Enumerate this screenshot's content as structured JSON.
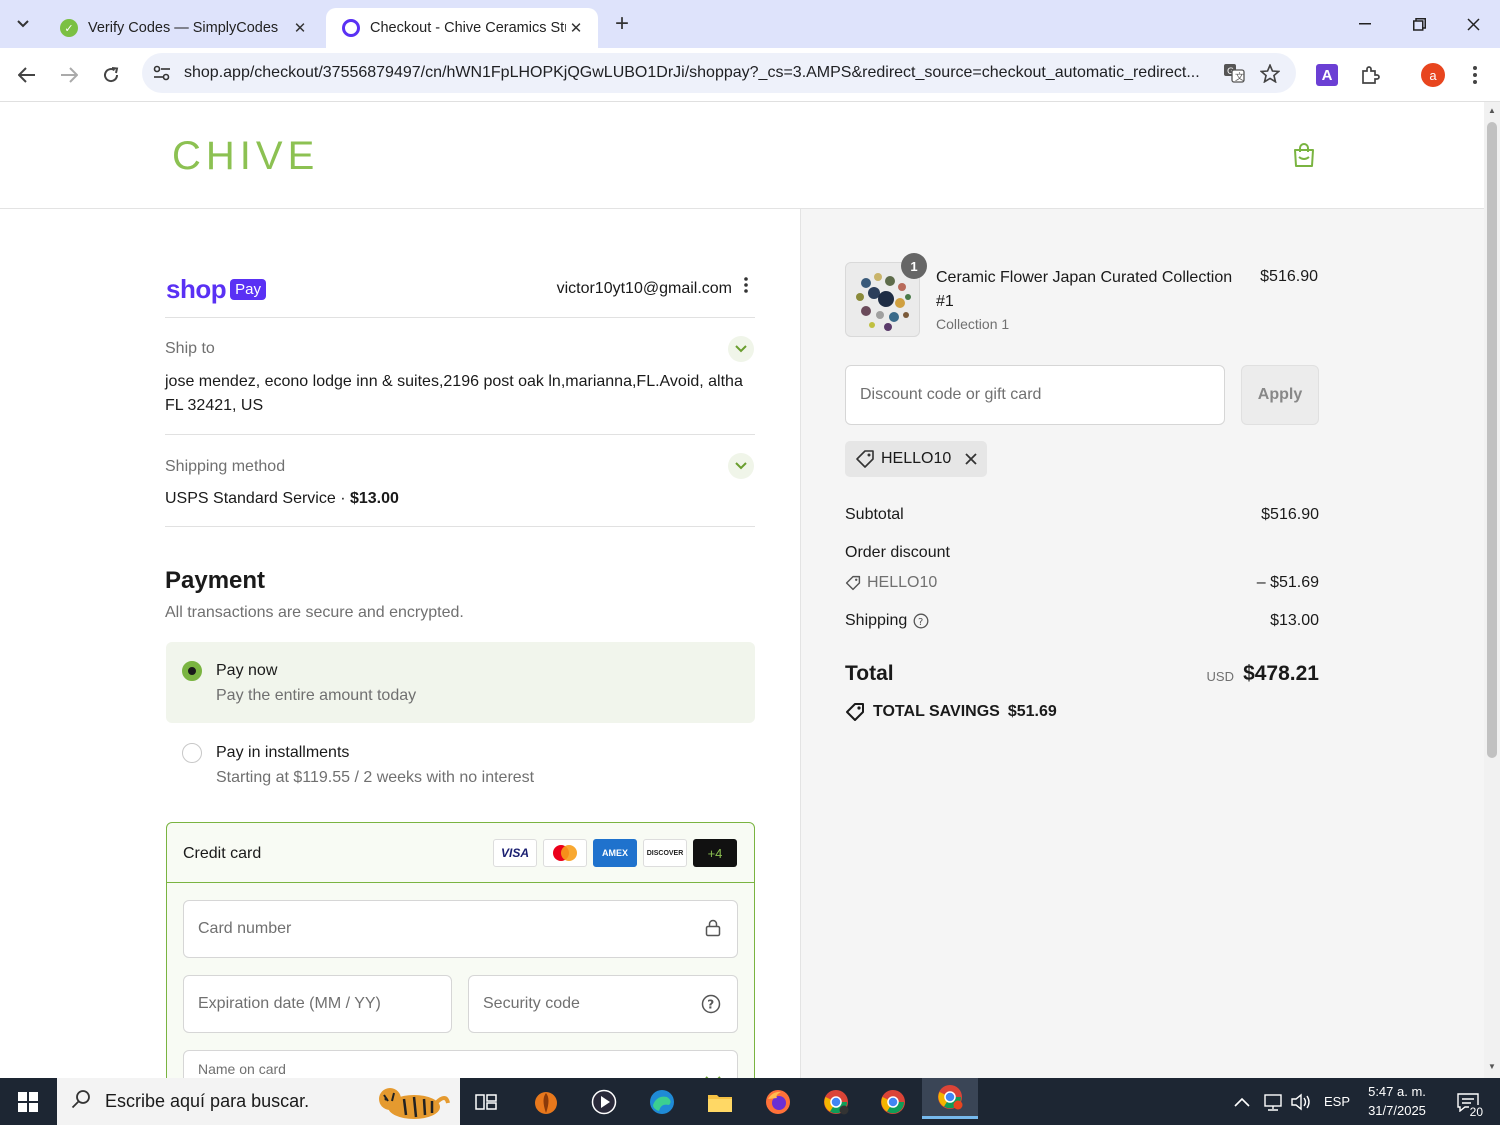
{
  "browser": {
    "tabs": [
      {
        "title": "Verify Codes — SimplyCodes",
        "icon": "simplycodes-icon"
      },
      {
        "title": "Checkout - Chive Ceramics Stud",
        "icon": "shop-icon"
      }
    ],
    "url": "shop.app/checkout/37556879497/cn/hWN1FpLHOPKjQGwLUBO1DrJi/shoppay?_cs=3.AMPS&redirect_source=checkout_automatic_redirect...",
    "profile_initial": "a",
    "extension_letter": "A"
  },
  "header": {
    "logo": "CHIVE"
  },
  "shop_pay": {
    "brand": "shop",
    "badge": "Pay",
    "email": "victor10yt10@gmail.com"
  },
  "ship_to": {
    "label": "Ship to",
    "line1": "jose mendez, econo lodge inn & suites,2196 post oak ln,marianna,FL.Avoid, altha",
    "line2": "FL 32421, US"
  },
  "shipping_method": {
    "label": "Shipping method",
    "service": "USPS Standard Service",
    "separator": " · ",
    "price": "$13.00"
  },
  "payment": {
    "title": "Payment",
    "subtitle": "All transactions are secure and encrypted.",
    "options": [
      {
        "title": "Pay now",
        "subtitle": "Pay the entire amount today",
        "selected": true
      },
      {
        "title": "Pay in installments",
        "subtitle": "Starting at $119.55 / 2 weeks with no interest",
        "selected": false
      }
    ],
    "credit_card": {
      "title": "Credit card",
      "logos": [
        "VISA",
        "MASTERCARD",
        "AMEX",
        "DISCOVER"
      ],
      "more": "+4",
      "fields": {
        "card_number": "Card number",
        "expiration": "Expiration date (MM / YY)",
        "security": "Security code",
        "name": "Name on card"
      }
    }
  },
  "order": {
    "product": {
      "title": "Ceramic Flower Japan Curated Collection #1",
      "variant": "Collection 1",
      "price": "$516.90",
      "quantity": "1"
    },
    "discount_placeholder": "Discount code or gift card",
    "apply_label": "Apply",
    "applied_code": "HELLO10",
    "subtotal_label": "Subtotal",
    "subtotal": "$516.90",
    "order_discount_label": "Order discount",
    "discount_code": "HELLO10",
    "discount_amount": "– $51.69",
    "shipping_label": "Shipping",
    "shipping": "$13.00",
    "total_label": "Total",
    "currency": "USD",
    "total": "$478.21",
    "savings_label": "TOTAL SAVINGS",
    "savings": "$51.69"
  },
  "taskbar": {
    "search_placeholder": "Escribe aquí para buscar.",
    "language": "ESP",
    "time": "5:47 a. m.",
    "date": "31/7/2025",
    "notifications": "20"
  },
  "colors": {
    "accent_green": "#7ab441",
    "shop_purple": "#5a31f4",
    "logo_green": "#8cc152"
  }
}
